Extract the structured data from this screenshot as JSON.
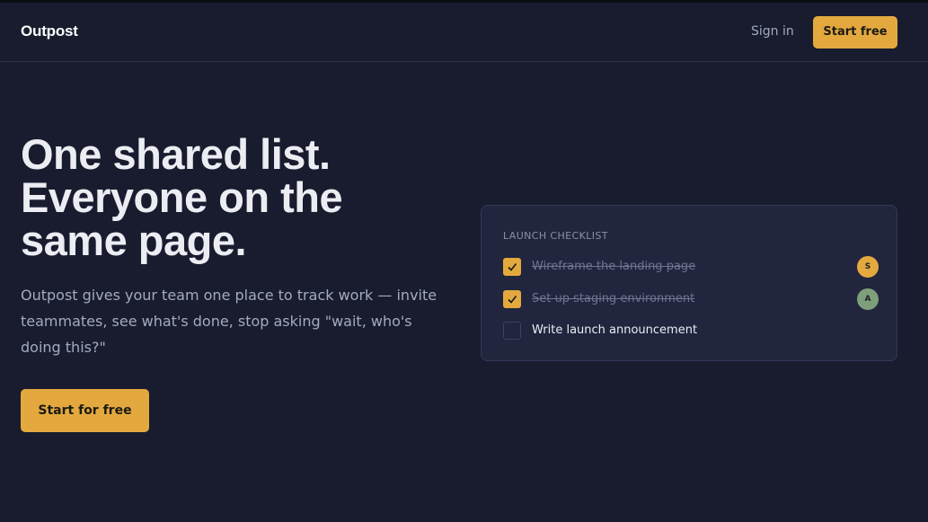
{
  "nav": {
    "brand": "Outpost",
    "signin_label": "Sign in",
    "cta_label": "Start free"
  },
  "hero": {
    "headline_lines": [
      "One shared list.",
      "Everyone on the",
      "same page."
    ],
    "subtext": "Outpost gives your team one place to track work — invite teammates, see what's done, stop asking \"wait, who's doing this?\"",
    "cta_label": "Start for free"
  },
  "checklist": {
    "title": "LAUNCH CHECKLIST",
    "items": [
      {
        "label": "Wireframe the landing page",
        "checked": true,
        "assignee": "S",
        "assignee_color": "#e3a93f"
      },
      {
        "label": "Set up staging environment",
        "checked": true,
        "assignee": "A",
        "assignee_color": "#7f9f7a"
      },
      {
        "label": "Write launch announcement",
        "checked": false,
        "assignee": "",
        "assignee_color": ""
      }
    ]
  },
  "colors": {
    "background": "#181c2e",
    "accent": "#e3a93f",
    "card": "#21253d"
  }
}
